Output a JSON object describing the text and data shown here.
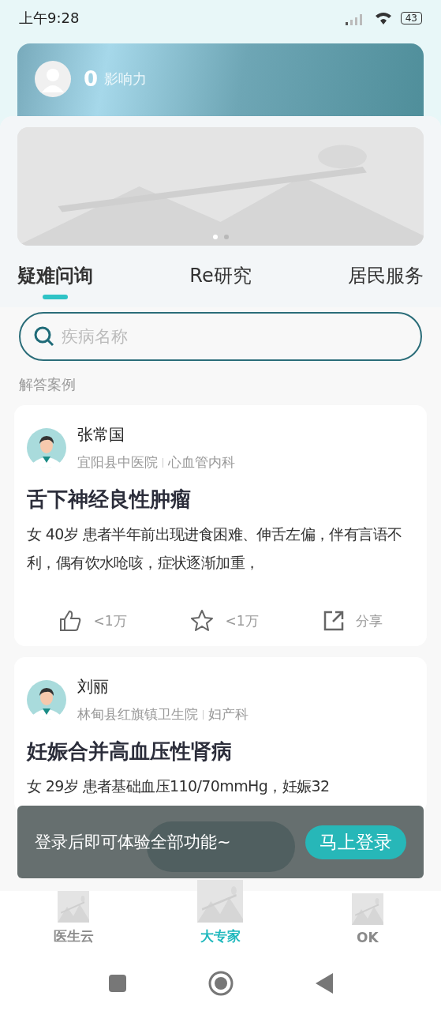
{
  "status_bar": {
    "time": "上午9:28",
    "battery": "43"
  },
  "profile": {
    "score": "0",
    "label": "影响力"
  },
  "banner": {
    "kind": "picture",
    "dots": [
      {
        "selected": true
      },
      {
        "selected": false
      }
    ]
  },
  "tabs": [
    {
      "label": "疑难问询",
      "selected": true
    },
    {
      "label": "Re研究",
      "selected": false
    },
    {
      "label": "居民服务",
      "selected": false
    }
  ],
  "search": {
    "placeholder": "疾病名称"
  },
  "section_title": "解答案例",
  "cases": [
    {
      "doctor": "张常国",
      "hospital": "宜阳县中医院",
      "department": "心血管内科",
      "title": "舌下神经良性肿瘤",
      "description": "女 40岁 患者半年前出现进食困难、伸舌左偏，伴有言语不利，偶有饮水呛咳，症状逐渐加重，",
      "likes": "<1万",
      "favorites": "<1万",
      "share": "分享"
    },
    {
      "doctor": "刘丽",
      "hospital": "林甸县红旗镇卫生院",
      "department": "妇产科",
      "title": "妊娠合并高血压性肾病",
      "description": "女 29岁 患者基础血压110/70mmHg，妊娠32"
    }
  ],
  "toast": {
    "message": "登录后即可体验全部功能~",
    "action": "马上登录"
  },
  "bottom_nav": [
    {
      "label": "医生云",
      "selected": false
    },
    {
      "label": "大专家",
      "selected": true
    },
    {
      "label": "OK",
      "selected": false
    }
  ]
}
